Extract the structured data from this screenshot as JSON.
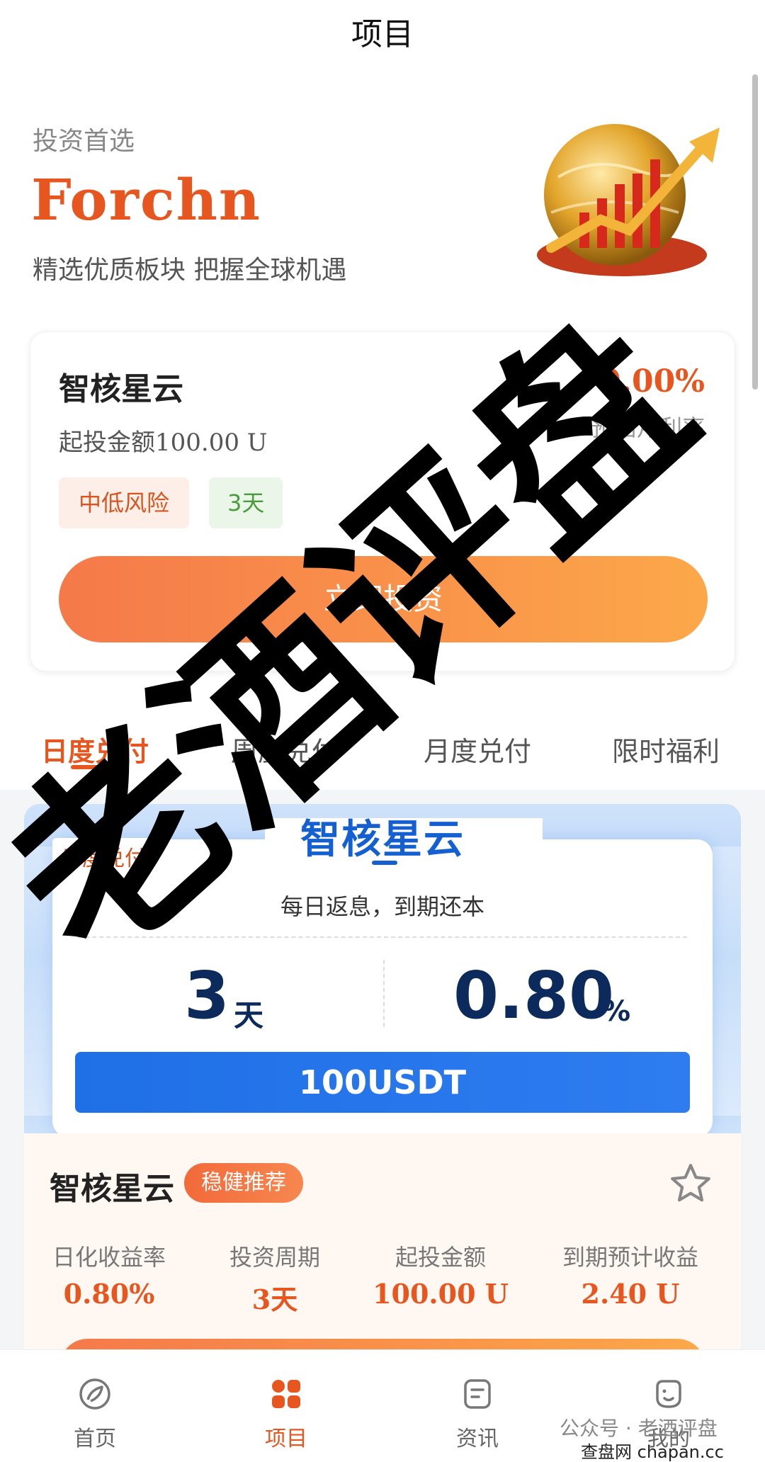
{
  "header": {
    "title": "项目"
  },
  "hero": {
    "subtitle": "投资首选",
    "brand": "Forchn",
    "slogan": "精选优质板块 把握全球机遇",
    "image_icon": "globe-chart-icon"
  },
  "featured": {
    "name": "智核星云",
    "rate": "0.00%",
    "rate_label": "预估月利率",
    "min_invest": "起投金额100.00 U",
    "risk_tag": "中低风险",
    "days_tag": "3天",
    "button_label": "立即投资"
  },
  "tabs": [
    {
      "label": "日度兑付",
      "active": true
    },
    {
      "label": "周度兑付",
      "active": false
    },
    {
      "label": "月度兑付",
      "active": false
    },
    {
      "label": "限时福利",
      "active": false
    }
  ],
  "product": {
    "banner": {
      "corner_tag": "日度兑付",
      "title": "智核星云",
      "subtitle": "每日返息，到期还本",
      "days": "3",
      "days_unit": "天",
      "rate": "0.80",
      "rate_unit": "%",
      "amount": "100USDT"
    },
    "detail": {
      "name": "智核星云",
      "badge": "稳健推荐",
      "star_icon": "star-outline-icon",
      "stats": [
        {
          "label": "日化收益率",
          "value": "0.80%"
        },
        {
          "label": "投资周期",
          "value": "3天"
        },
        {
          "label": "起投金额",
          "value": "100.00 U"
        },
        {
          "label": "到期预计收益",
          "value": "2.40 U"
        }
      ]
    }
  },
  "bottom_nav": [
    {
      "label": "首页",
      "icon": "home-icon",
      "active": false
    },
    {
      "label": "项目",
      "icon": "grid-icon",
      "active": true
    },
    {
      "label": "资讯",
      "icon": "news-icon",
      "active": false
    },
    {
      "label": "我的",
      "icon": "profile-icon",
      "active": false
    }
  ],
  "overlay": {
    "watermark_text": "老酒评盘",
    "footer_credit": "公众号 · 老酒评盘",
    "site_credit": "查盘网 chapan.cc"
  },
  "colors": {
    "accent": "#e8561f",
    "blue": "#1560d0",
    "navy": "#0c2a5c"
  }
}
